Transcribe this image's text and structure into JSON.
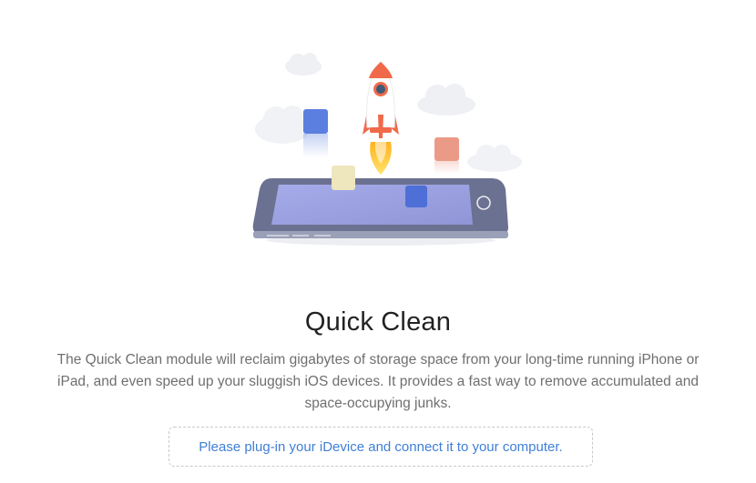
{
  "module": {
    "title": "Quick Clean",
    "description": "The Quick Clean module will reclaim gigabytes of storage space from your long-time running iPhone or iPad, and even speed up your sluggish iOS devices. It provides a fast way to remove accumulated and space-occupying junks.",
    "prompt": "Please plug-in your iDevice and connect it to your computer."
  },
  "illustration": {
    "icons": [
      "cloud-icon",
      "rocket-icon",
      "tablet-icon",
      "app-tile-icon"
    ],
    "colors": {
      "cloud": "#eef0f3",
      "tablet_body": "#6b7190",
      "tablet_screen": "#9aa0dc",
      "rocket_body": "#ffffff",
      "rocket_accent": "#f06a4a",
      "flame_outer": "#ffd84d",
      "flame_inner": "#ffb21e",
      "tile_blue": "#5b7fe0",
      "tile_salmon": "#ec9a88",
      "tile_cream": "#eee6bd",
      "tile_blue_small": "#4d6fd6"
    }
  }
}
